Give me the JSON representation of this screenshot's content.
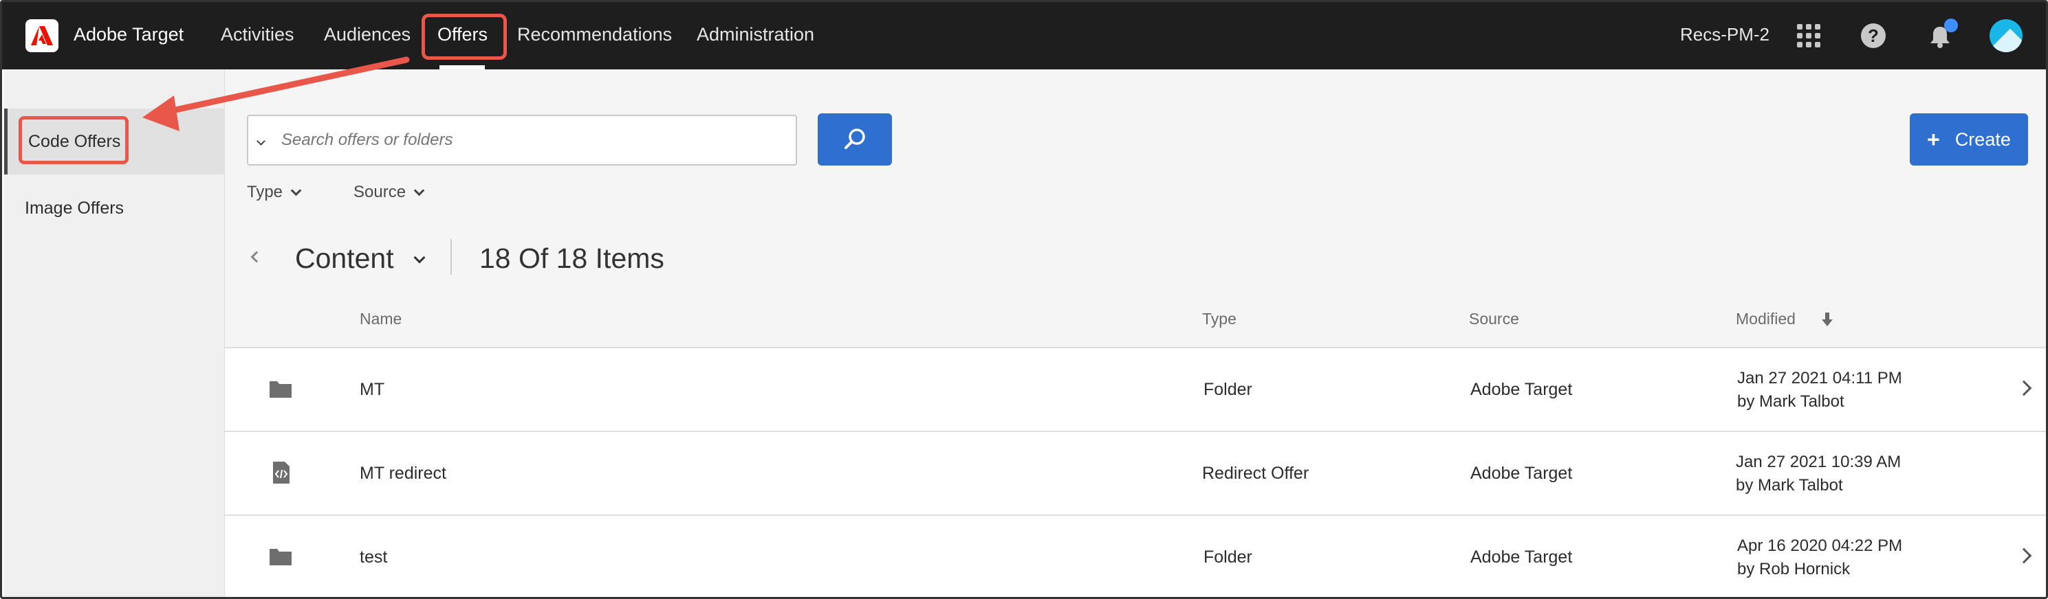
{
  "header": {
    "brand": "Adobe Target",
    "nav": [
      "Activities",
      "Audiences",
      "Offers",
      "Recommendations",
      "Administration"
    ],
    "active_nav": "Offers",
    "workspace": "Recs-PM-2",
    "help_glyph": "?"
  },
  "sidebar": {
    "items": [
      {
        "label": "Code Offers",
        "active": true
      },
      {
        "label": "Image Offers",
        "active": false
      }
    ]
  },
  "toolbar": {
    "search_placeholder": "Search offers or folders",
    "create_label": "Create",
    "filters": [
      "Type",
      "Source"
    ]
  },
  "listing": {
    "folder": "Content",
    "count_text": "18 Of 18 Items",
    "columns": [
      "Name",
      "Type",
      "Source",
      "Modified"
    ],
    "rows": [
      {
        "icon": "folder-icon",
        "name": "MT",
        "type": "Folder",
        "source": "Adobe Target",
        "date": "Jan 27 2021  04:11 PM",
        "by": "by Mark Talbot",
        "has_chevron": true
      },
      {
        "icon": "code-file-icon",
        "name": "MT redirect",
        "type": "Redirect Offer",
        "source": "Adobe Target",
        "date": "Jan 27 2021  10:39 AM",
        "by": "by Mark Talbot",
        "has_chevron": false
      },
      {
        "icon": "folder-icon",
        "name": "test",
        "type": "Folder",
        "source": "Adobe Target",
        "date": "Apr 16 2020  04:22 PM",
        "by": "by Rob Hornick",
        "has_chevron": true
      }
    ]
  },
  "colors": {
    "topbar": "#1e1e1e",
    "accent_blue": "#2f6fd0",
    "annotation_red": "#e8574a"
  }
}
